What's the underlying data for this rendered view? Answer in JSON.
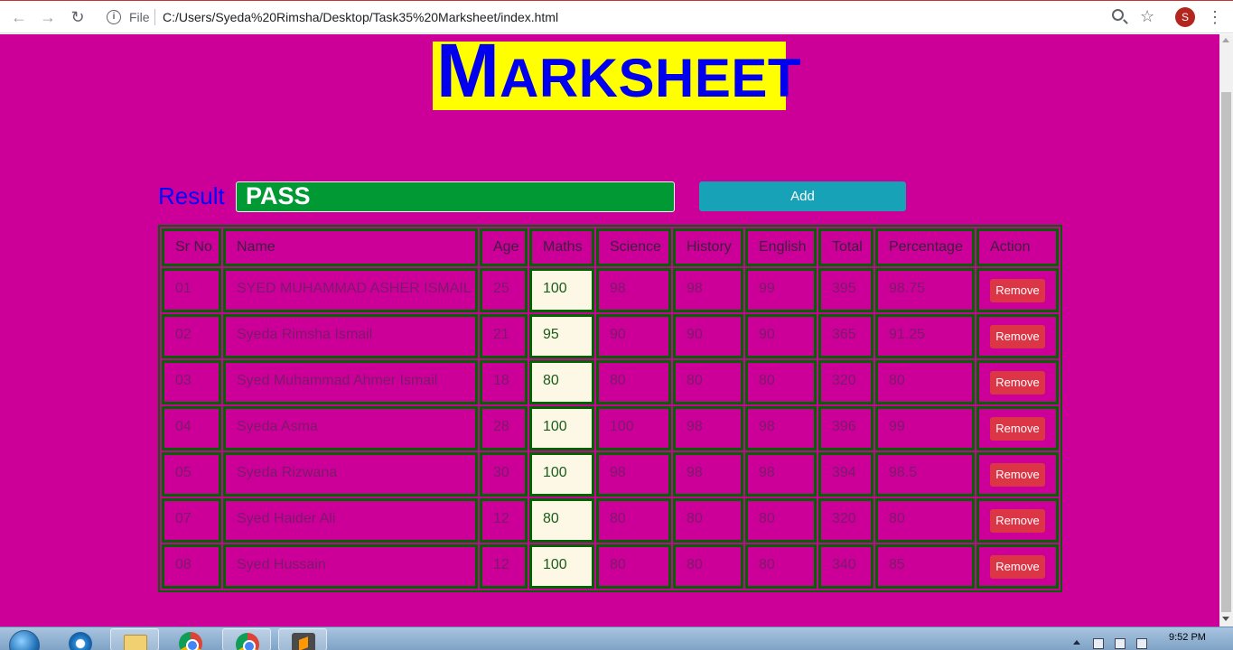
{
  "browser": {
    "file_label": "File",
    "url": "C:/Users/Syeda%20Rimsha/Desktop/Task35%20Marksheet/index.html",
    "profile_initial": "S"
  },
  "page": {
    "title_first": "M",
    "title_rest": "ARKSHEET",
    "result_label": "Result",
    "result_value": "PASS",
    "add_label": "Add",
    "colors": {
      "background": "#cc0099",
      "title_bg": "#ffff00",
      "title_text": "#0000ee",
      "result_input": "#009933",
      "add_button": "#17a2b8",
      "remove_button": "#dc3545",
      "table_border": "#006400"
    }
  },
  "table": {
    "headers": [
      "Sr No",
      "Name",
      "Age",
      "Maths",
      "Science",
      "History",
      "English",
      "Total",
      "Percentage",
      "Action"
    ],
    "action_label": "Remove",
    "rows": [
      [
        "01",
        "SYED MUHAMMAD ASHER ISMAIL",
        "25",
        "100",
        "98",
        "98",
        "99",
        "395",
        "98.75"
      ],
      [
        "02",
        "Syeda Rimsha Ismail",
        "21",
        "95",
        "90",
        "90",
        "90",
        "365",
        "91.25"
      ],
      [
        "03",
        "Syed Muhammad Ahmer Ismail",
        "18",
        "80",
        "80",
        "80",
        "80",
        "320",
        "80"
      ],
      [
        "04",
        "Syeda Asma",
        "28",
        "100",
        "100",
        "98",
        "98",
        "396",
        "99"
      ],
      [
        "05",
        "Syeda Rizwana",
        "30",
        "100",
        "98",
        "98",
        "98",
        "394",
        "98.5"
      ],
      [
        "07",
        "Syed Haider Ali",
        "12",
        "80",
        "80",
        "80",
        "80",
        "320",
        "80"
      ],
      [
        "08",
        "Syed Hussain",
        "12",
        "100",
        "80",
        "80",
        "80",
        "340",
        "85"
      ]
    ]
  },
  "taskbar": {
    "clock": "9:52 PM"
  }
}
